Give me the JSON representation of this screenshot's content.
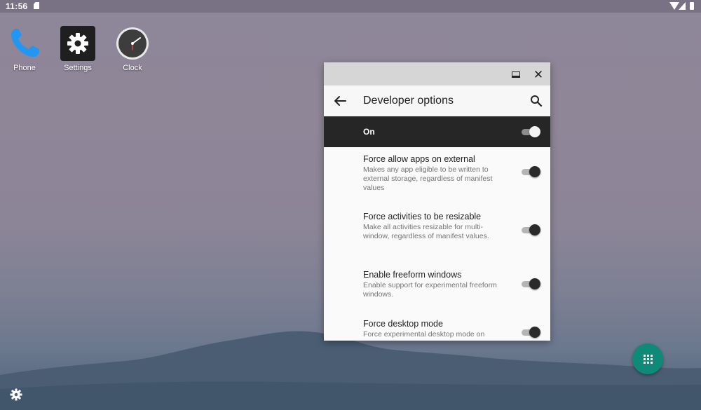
{
  "status_bar": {
    "time": "11:56",
    "icons": [
      "sd-card-icon",
      "wifi-icon",
      "signal-icon",
      "battery-icon"
    ]
  },
  "desktop": {
    "apps": [
      {
        "label": "Phone",
        "icon": "phone-icon"
      },
      {
        "label": "Settings",
        "icon": "gear-icon"
      },
      {
        "label": "Clock",
        "icon": "clock-icon"
      }
    ],
    "bottom_icon": "gear-icon",
    "app_drawer_icon": "grid-icon"
  },
  "window": {
    "caption_icons": [
      "maximize-icon",
      "close-icon"
    ],
    "title": "Developer options",
    "master_toggle": {
      "label": "On",
      "checked": true
    },
    "settings": [
      {
        "title": "Force allow apps on external",
        "summary": "Makes any app eligible to be written to external storage, regardless of manifest values",
        "checked": true
      },
      {
        "title": "Force activities to be resizable",
        "summary": "Make all activities resizable for multi-window, regardless of manifest values.",
        "checked": true
      },
      {
        "title": "Enable freeform windows",
        "summary": "Enable support for experimental freeform windows.",
        "checked": true
      },
      {
        "title": "Force desktop mode",
        "summary": "Force experimental desktop mode on",
        "checked": true
      }
    ]
  },
  "colors": {
    "fab": "#0f8a78",
    "master_bar": "#262626",
    "caption_bar": "#d6d6d6"
  }
}
